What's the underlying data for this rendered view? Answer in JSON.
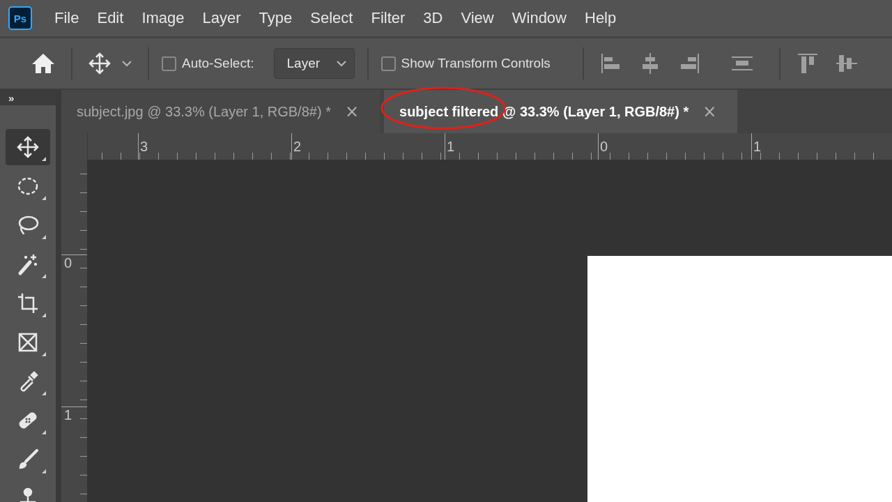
{
  "app": {
    "logo": "Ps"
  },
  "menu": [
    "File",
    "Edit",
    "Image",
    "Layer",
    "Type",
    "Select",
    "Filter",
    "3D",
    "View",
    "Window",
    "Help"
  ],
  "options_bar": {
    "auto_select": {
      "label": "Auto-Select:",
      "checked": false
    },
    "auto_select_target": "Layer",
    "transform_controls": {
      "label": "Show Transform Controls",
      "checked": false
    },
    "align_buttons": [
      {
        "kind": "left"
      },
      {
        "kind": "hcenter"
      },
      {
        "kind": "right"
      },
      {
        "kind": "distribute"
      },
      {
        "kind": "top"
      },
      {
        "kind": "vcenter"
      }
    ]
  },
  "panel_toggle": "»",
  "tabs": [
    {
      "label": "subject.jpg @ 33.3% (Layer 1, RGB/8#) *",
      "close": "×",
      "selected": false,
      "circled": false
    },
    {
      "label": "subject filtered @ 33.3% (Layer 1, RGB/8#) *",
      "close": "×",
      "selected": true,
      "circled": true
    }
  ],
  "tools": [
    {
      "kind": "move",
      "selected": true
    },
    {
      "kind": "marquee",
      "selected": false
    },
    {
      "kind": "lasso",
      "selected": false
    },
    {
      "kind": "wand",
      "selected": false
    },
    {
      "kind": "crop",
      "selected": false
    },
    {
      "kind": "frame",
      "selected": false
    },
    {
      "kind": "eyedropper",
      "selected": false
    },
    {
      "kind": "healing",
      "selected": false
    },
    {
      "kind": "brush",
      "selected": false
    },
    {
      "kind": "stamp",
      "selected": false
    }
  ],
  "ruler_horizontal": [
    "3",
    "2",
    "1",
    "0",
    "1"
  ],
  "ruler_vertical": [
    "0",
    "1"
  ]
}
